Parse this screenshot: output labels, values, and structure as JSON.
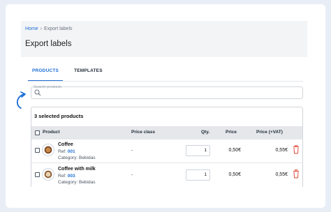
{
  "breadcrumb": {
    "home": "Home",
    "separator": "›",
    "current": "Export labels"
  },
  "page_title": "Export labels",
  "tabs": [
    {
      "label": "PRODUCTS",
      "active": true
    },
    {
      "label": "TEMPLATES",
      "active": false
    }
  ],
  "search": {
    "label": "Search products",
    "value": ""
  },
  "selection": {
    "summary": "3 selected products"
  },
  "table": {
    "headers": {
      "product": "Product",
      "price_class": "Price class",
      "qty": "Qty.",
      "price": "Price",
      "price_vat": "Price (+VAT)"
    },
    "rows": [
      {
        "name": "Coffee",
        "ref_label": "Ref:",
        "ref": "001",
        "category": "Category: Bebidas",
        "price_class": "-",
        "qty": "1",
        "price": "0,50€",
        "price_vat": "0,55€"
      },
      {
        "name": "Coffee with milk",
        "ref_label": "Ref:",
        "ref": "003",
        "category": "Category: Bebidas",
        "price_class": "-",
        "qty": "1",
        "price": "0,50€",
        "price_vat": "0,55€"
      }
    ]
  },
  "colors": {
    "accent": "#1d6fd6",
    "danger": "#e24a3b",
    "background": "#e9eef6"
  },
  "icons": {
    "search": "search-icon",
    "delete": "trash-icon",
    "annotation": "curved-arrow-icon"
  }
}
